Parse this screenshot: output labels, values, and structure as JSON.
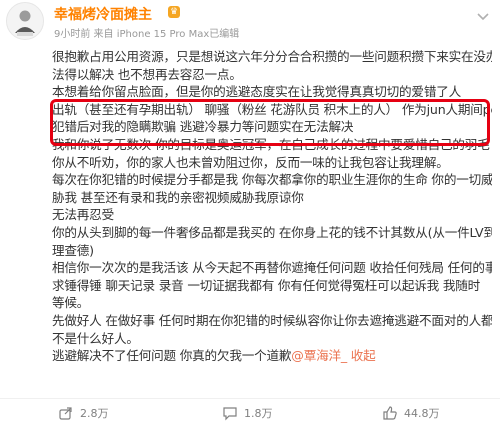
{
  "post": {
    "username": "幸福烤冷面摊主",
    "badge": "♛",
    "meta": "9小时前 来自 iPhone 15 Pro Max已编辑",
    "lines": [
      "很抱歉占用公用资源，只是想说这六年分分合合积攒的一些问题积攒下来实在没办",
      "法得以解决 也不想再去容忍一点。",
      "本想着给你留点脸面，但是你的逃避态度实在让我觉得真真切切的爱错了人",
      "出轨（甚至还有孕期出轨） 聊骚（粉丝 花游队员 积木上的人） 作为jun人期间pc",
      "犯错后对我的隐瞒欺骗 逃避冷暴力等问题实在无法解决",
      "我和你说了无数次 你的目标是奥运冠军，在自己成长的过程中要爱惜自己的羽毛",
      "你从不听劝，你的家人也未曾劝阻过你，反而一味的让我包容让我理解。",
      "每次在你犯错的时候提分手都是我 你每次都拿你的职业生涯你的生命 你的一切威",
      "胁我 甚至还有录和我的亲密视频威胁我原谅你",
      "无法再忍受",
      " 你的从头到脚的每一件奢侈品都是我买的 在你身上花的钱不计其数从(从一件LV到",
      "理查德)",
      "相信你一次次的是我活该 从今天起不再替你遮掩任何问题 收拾任何残局 任何的事",
      "求锤得锤  聊天记录 录音 一切证据我都有 你有任何觉得冤枉可以起诉我 我随时",
      "等候。",
      "先做好人 在做好事 任何时期在你犯错的时候纵容你让你去遮掩逃避不面对的人都",
      "不是什么好人。"
    ],
    "last_line_text": "逃避解决不了任何问题 你真的欠我一个道歉",
    "mention": "@覃海洋_",
    "last_line_suffix": " 收起"
  },
  "footer": {
    "share_count": "2.8万",
    "comment_count": "1.8万",
    "like_count": "44.8万"
  },
  "icons": {
    "more": "more-icon",
    "share": "share-icon",
    "comment": "comment-icon",
    "like": "like-icon"
  },
  "colors": {
    "username": "#ff8200",
    "mention": "#eb7350",
    "highlight_box": "#e60012",
    "meta": "#999999"
  }
}
